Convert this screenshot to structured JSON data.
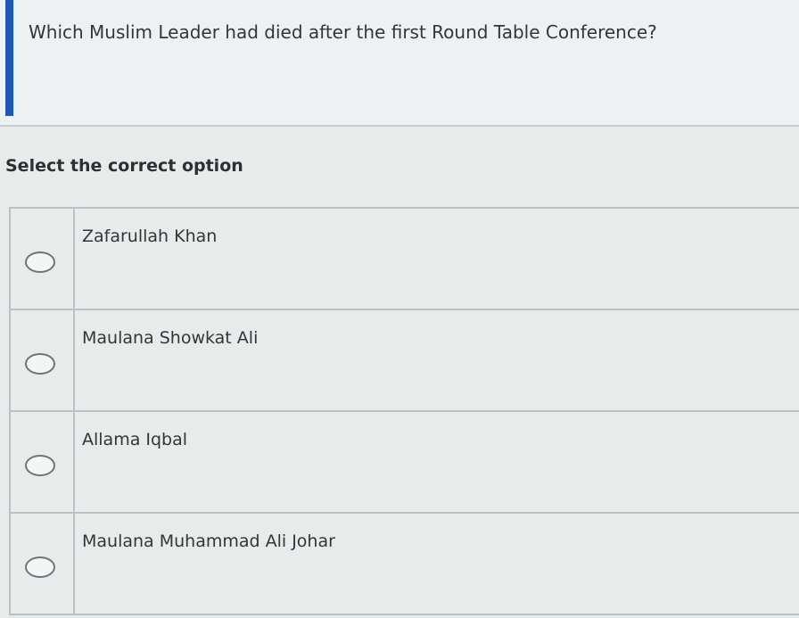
{
  "question": {
    "text": "Which Muslim Leader had died after the first Round Table Conference?"
  },
  "instruction": "Select the correct option",
  "options": [
    {
      "label": "Zafarullah Khan",
      "selected": false
    },
    {
      "label": "Maulana Showkat Ali",
      "selected": false
    },
    {
      "label": "Allama Iqbal",
      "selected": false
    },
    {
      "label": "Maulana Muhammad Ali Johar",
      "selected": false
    }
  ],
  "colors": {
    "accent": "#1f57b8",
    "background": "#e7ebea",
    "border": "#b9c3c4"
  }
}
